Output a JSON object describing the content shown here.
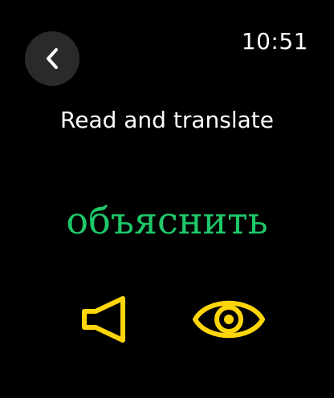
{
  "status_bar": {
    "time": "10:51"
  },
  "navigation": {
    "back_icon": "chevron-left-icon"
  },
  "prompt": {
    "text": "Read and translate"
  },
  "card": {
    "word": "объяснить",
    "word_color": "#1ec96a"
  },
  "controls": {
    "speaker_icon": "speaker-icon",
    "reveal_icon": "eye-icon",
    "icon_color": "#ffd60a"
  },
  "colors": {
    "background": "#000000",
    "back_button_bg": "#2a2a2a",
    "text": "#ffffff"
  }
}
